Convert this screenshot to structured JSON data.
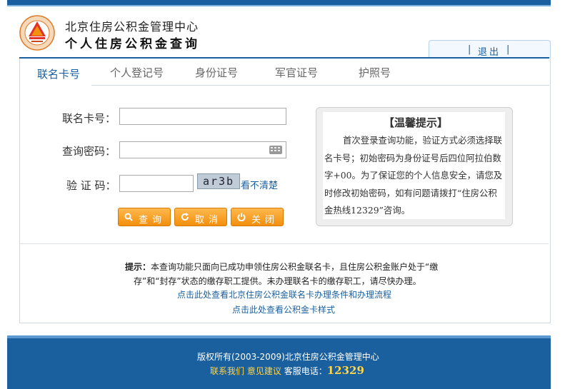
{
  "header": {
    "title_line1": "北京住房公积金管理中心",
    "title_line2": "个人住房公积金查询",
    "logout_sep": "|",
    "logout_label": "退出",
    "logout_sep2": "|"
  },
  "tabs": [
    {
      "label": "联名卡号",
      "active": true
    },
    {
      "label": "个人登记号",
      "active": false
    },
    {
      "label": "身份证号",
      "active": false
    },
    {
      "label": "军官证号",
      "active": false
    },
    {
      "label": "护照号",
      "active": false
    }
  ],
  "form": {
    "card_label": "联名卡号：",
    "card_value": "",
    "password_label": "查询密码：",
    "password_value": "",
    "captcha_label": "验 证 码：",
    "captcha_value": "",
    "captcha_text": "ar3b",
    "captcha_refresh": "看不清楚"
  },
  "buttons": {
    "query": "查询",
    "cancel": "取消",
    "close": "关闭"
  },
  "tip": {
    "title": "【温馨提示】",
    "body": "首次登录查询功能，验证方式必须选择联名卡号；初始密码为身份证号后四位阿拉伯数字+00。为了保证您的个人信息安全，请您及时修改初始密码，如有问题请拨打“住房公积金热线12329”咨询。"
  },
  "notice": {
    "prefix": "提示：",
    "line1": "本查询功能只面向已成功申领住房公积金联名卡，且住房公积金账户处于“缴",
    "line2": "存”和“封存”状态的缴存职工提供。未办理联名卡的缴存职工，请尽快办理。",
    "link1": "点击此处查看北京住房公积金联名卡办理条件和办理流程",
    "link2": "点击此处查看公积金卡样式"
  },
  "footer": {
    "copyright": "版权所有(2003-2009)北京住房公积金管理中心",
    "contact": "联系我们",
    "feedback": "意见建议",
    "hotline_label": "客服电话：",
    "hotline": "12329"
  },
  "colors": {
    "brand_blue": "#1a5f9e",
    "button_orange": "#f28f0d"
  }
}
